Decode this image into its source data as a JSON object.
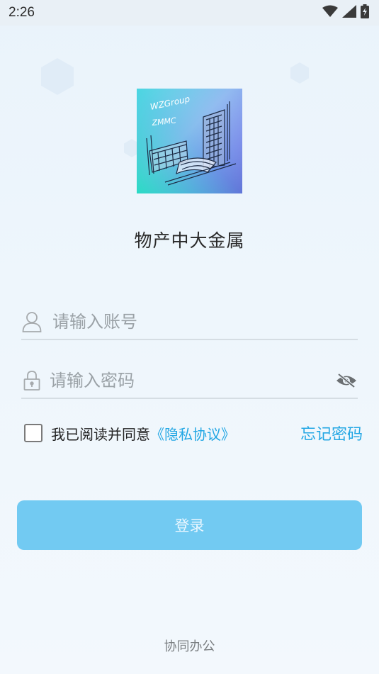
{
  "status_bar": {
    "time": "2:26",
    "icons": [
      "wifi-icon",
      "signal-icon",
      "battery-charging-icon"
    ]
  },
  "app": {
    "name": "物产中大金属",
    "logo_text_line1": "WZGroup",
    "logo_text_line2": "ZMMC"
  },
  "login_form": {
    "username_placeholder": "请输入账号",
    "password_placeholder": "请输入密码",
    "agreement_text": "我已阅读并同意",
    "privacy_link": "《隐私协议》",
    "forgot_password": "忘记密码",
    "login_button": "登录"
  },
  "footer": {
    "text": "协同办公"
  },
  "colors": {
    "accent": "#23a7e4",
    "button": "#72caf2",
    "background": "#eef6fc"
  }
}
